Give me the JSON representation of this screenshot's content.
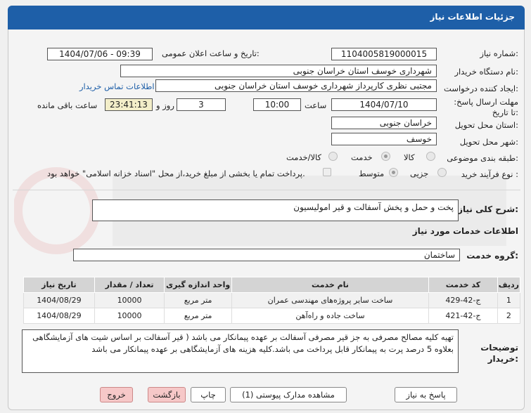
{
  "header": {
    "title": "جزئیات اطلاعات نیاز"
  },
  "fields": {
    "need_number_label": "شماره نیاز:",
    "need_number": "1104005819000015",
    "announce_label": "تاریخ و ساعت اعلان عمومی:",
    "announce_value": "1404/07/06 - 09:39",
    "buyer_label": "نام دستگاه خریدار:",
    "buyer_value": "شهرداری خوسف استان خراسان جنوبی",
    "creator_label": "ایجاد کننده درخواست:",
    "creator_value": "مجتبی نظری کارپرداز شهرداری خوسف استان خراسان جنوبی",
    "contact_link": "اطلاعات تماس خریدار",
    "deadline_label": "مهلت ارسال پاسخ: تا تاریخ:",
    "deadline_date": "1404/07/10",
    "time_label": "ساعت",
    "deadline_time": "10:00",
    "days_value": "3",
    "days_label": "روز و",
    "remaining_time": "23:41:13",
    "remaining_label": "ساعت باقی مانده",
    "province_label": "استان محل تحویل:",
    "province_value": "خراسان جنوبی",
    "city_label": "شهر محل تحویل:",
    "city_value": "خوسف",
    "category_label": "طبقه بندی موضوعی:",
    "category_options": [
      "کالا",
      "خدمت",
      "کالا/خدمت"
    ],
    "category_selected": "خدمت",
    "process_label": "نوع فرآیند خرید :",
    "process_options": [
      "جزیی",
      "متوسط"
    ],
    "process_selected": "متوسط",
    "payment_note": "پرداخت تمام یا بخشی از مبلغ خرید،از محل \"اسناد خزانه اسلامی\" خواهد بود."
  },
  "summary": {
    "label": "شرح کلی نیاز:",
    "value": "پخت و حمل و پخش آسفالت و قیر امولیسیون"
  },
  "services": {
    "section_title": "اطلاعات خدمات مورد نیاز",
    "group_label": "گروه خدمت:",
    "group_value": "ساختمان",
    "columns": [
      "ردیف",
      "کد خدمت",
      "نام خدمت",
      "واحد اندازه گیری",
      "تعداد / مقدار",
      "تاریخ نیاز"
    ],
    "rows": [
      [
        "1",
        "ج-42-429",
        "ساخت سایر پروژه‌های مهندسی عمران",
        "متر مربع",
        "10000",
        "1404/08/29"
      ],
      [
        "2",
        "ج-42-421",
        "ساخت جاده و راه‌آهن",
        "متر مربع",
        "10000",
        "1404/08/29"
      ]
    ]
  },
  "buyer_notes": {
    "label": "توضیحات خریدار:",
    "text": "تهیه کلیه مصالح مصرفی به جز قیر مصرفی آسفالت بر عهده پیمانکار می باشد ( قیر آسفالت بر اساس شیت های آزمایشگاهی بعلاوه 5 درصد پرت به پیمانکار قابل پرداخت می باشد.کلیه هزینه های آزمایشگاهی بر عهده پیمانکار می باشد"
  },
  "buttons": {
    "reply": "پاسخ به نیاز",
    "attachments": "مشاهده مدارک پیوستی (1)",
    "print": "چاپ",
    "back": "بازگشت",
    "exit": "خروج"
  }
}
